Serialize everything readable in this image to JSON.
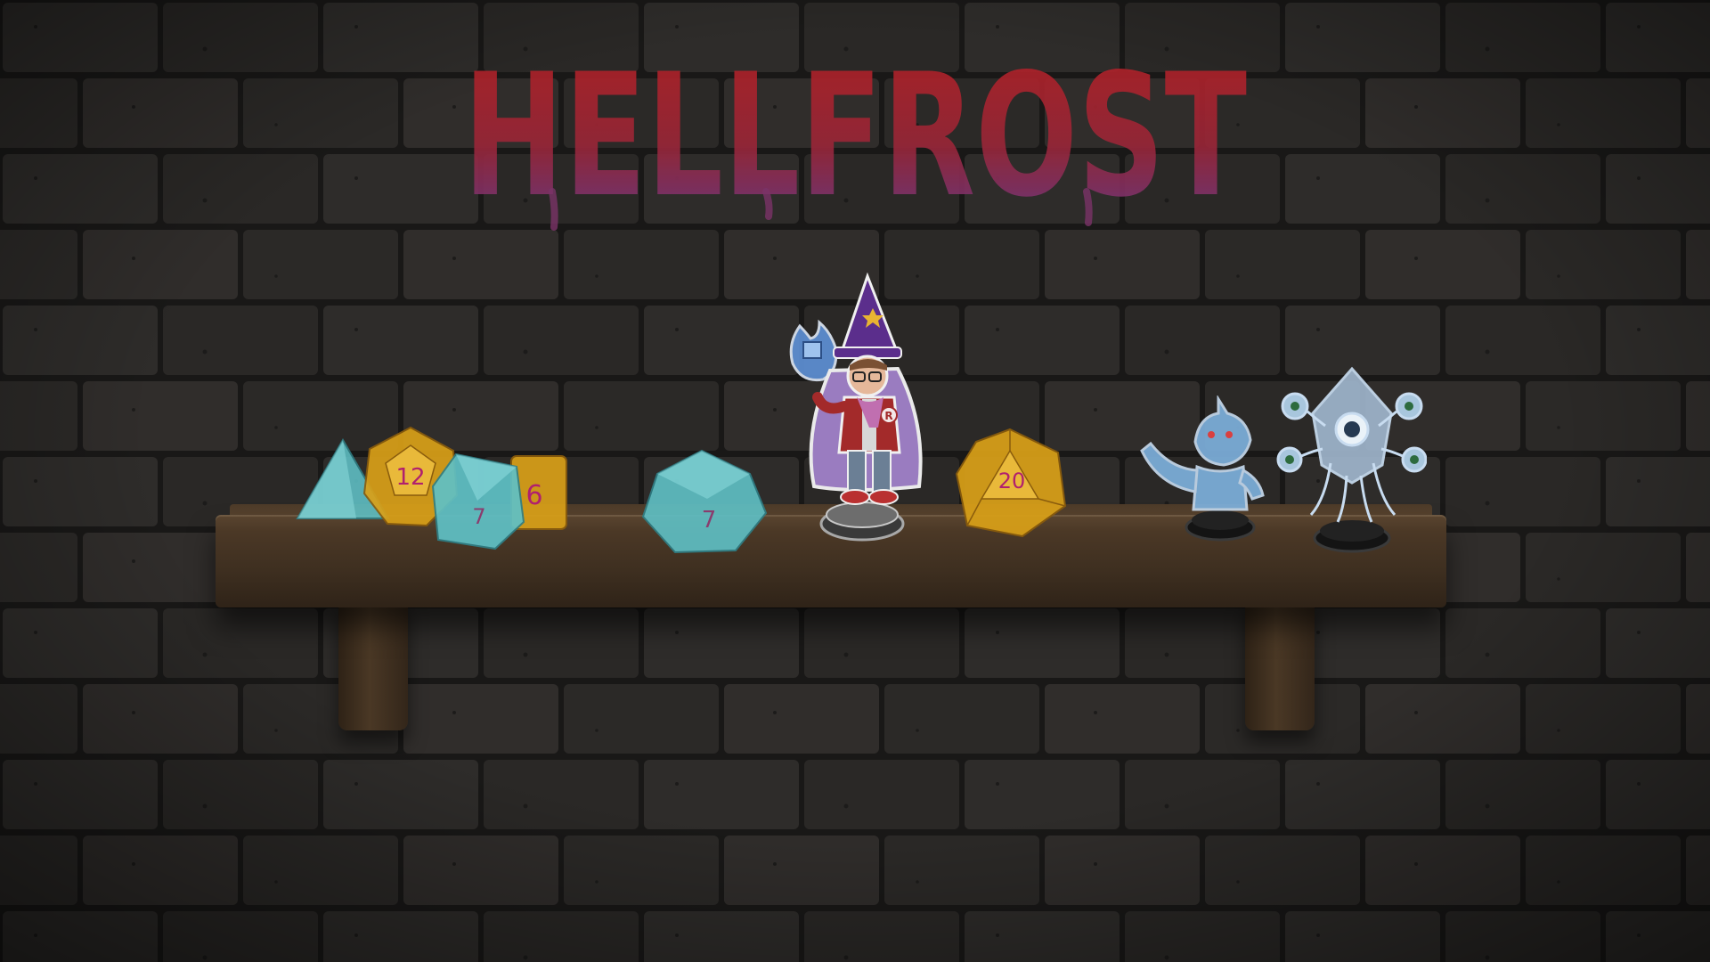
{
  "title": "HELLFROST",
  "colors": {
    "title_top": "#b82124",
    "title_bottom": "#6b3a8c",
    "wall_brick": "#2e2c2a",
    "wall_mortar": "#1a1918",
    "shelf_wood": "#4b3826",
    "amber_die": "#d9a018",
    "teal_die": "#5fc1c6",
    "die_numerals": "#b0206e",
    "wizard_hat": "#5b2e8c",
    "wizard_cape": "#9a7cc0",
    "wizard_jacket": "#a32a2a",
    "ghost_blue": "#7fb3e0"
  },
  "shelf_items": [
    {
      "id": "d4",
      "kind": "die",
      "color": "teal",
      "label": ""
    },
    {
      "id": "d12",
      "kind": "die",
      "color": "amber",
      "label": "12"
    },
    {
      "id": "d8",
      "kind": "die",
      "color": "teal",
      "label": "7"
    },
    {
      "id": "d6",
      "kind": "die",
      "color": "amber",
      "label": "6"
    },
    {
      "id": "d10",
      "kind": "die",
      "color": "teal",
      "label": "7"
    },
    {
      "id": "wizard",
      "kind": "miniature",
      "icon": "wizard-icon",
      "badge": "R"
    },
    {
      "id": "d20",
      "kind": "die",
      "color": "amber",
      "label": "20"
    },
    {
      "id": "goblin",
      "kind": "miniature",
      "icon": "goblin-icon"
    },
    {
      "id": "beholder",
      "kind": "miniature",
      "icon": "beholder-icon"
    }
  ]
}
